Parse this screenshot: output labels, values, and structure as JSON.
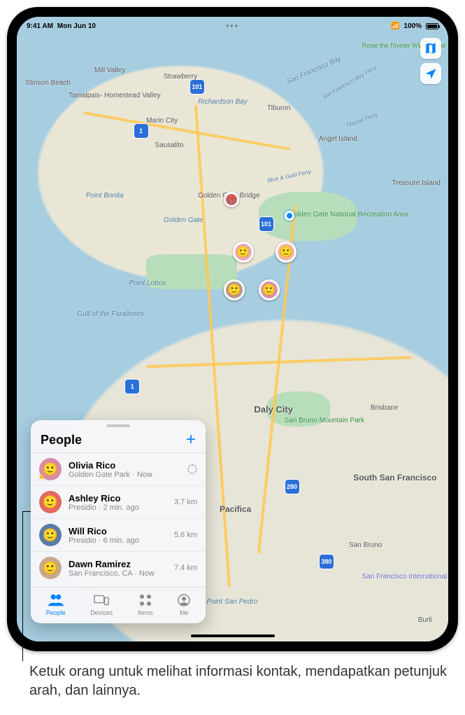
{
  "statusbar": {
    "time": "9:41 AM",
    "date": "Mon Jun 10",
    "battery": "100%"
  },
  "map_controls": {
    "maps_icon": "maps-icon",
    "locate_icon": "locate-icon"
  },
  "map_labels": {
    "mill_valley": "Mill Valley",
    "tamalpais": "Tamalpais-\nHomestead Valley",
    "strawberry": "Strawberry",
    "stinson": "Stinson Beach",
    "marin_city": "Marin City",
    "richardson_bay": "Richardson\nBay",
    "sausalito": "Sausalito",
    "tiburon": "Tiburon",
    "angel_island": "Angel\nIsland",
    "treasure_island": "Treasure\nIsland",
    "golden_gate_bridge": "Golden Gate\nBridge",
    "golden_gate": "Golden\nGate",
    "ggnra": "Golden Gate\nNational\nRecreation Area",
    "point_bonita": "Point Bonita",
    "point_lobos": "Point Lobos",
    "gulf": "Gulf\nof the\nFarallones",
    "daly_city": "Daly City",
    "brisbane": "Brisbane",
    "ssf": "South San\nFrancisco",
    "pacifica": "Pacifica",
    "san_bruno": "San Bruno",
    "burlingame": "Burli",
    "psp": "Point San Pedro",
    "san_bruno_park": "San Bruno\nMountain Park",
    "rosie": "Rosie the\nRiveter WWII\nHome Front\nNational\nHistorical Park",
    "sfo": "San Francisco\nInternational\nAirport",
    "sfbay": "San Francisco Bay",
    "bgferry": "Blue & Gold Ferry",
    "tibferry": "Tiburon Ferry",
    "sfbferry": "San Francisco Bay Ferry"
  },
  "shields": {
    "s1": "1",
    "s101": "101",
    "s280": "280",
    "s380": "380"
  },
  "panel": {
    "title": "People",
    "people": [
      {
        "name": "Olivia Rico",
        "sub": "Golden Gate Park · Now",
        "dist": "",
        "loading": true,
        "star": true,
        "av_bg": "#d88aa8"
      },
      {
        "name": "Ashley Rico",
        "sub": "Presidio · 2 min. ago",
        "dist": "3.7 km",
        "loading": false,
        "star": false,
        "av_bg": "#e06a60"
      },
      {
        "name": "Will Rico",
        "sub": "Presidio · 6 min. ago",
        "dist": "5.6 km",
        "loading": false,
        "star": false,
        "av_bg": "#5a7aa8"
      },
      {
        "name": "Dawn Ramirez",
        "sub": "San Francisco, CA · Now",
        "dist": "7.4 km",
        "loading": false,
        "star": false,
        "av_bg": "#c8a888"
      }
    ],
    "tabs": [
      {
        "id": "people",
        "label": "People",
        "active": true
      },
      {
        "id": "devices",
        "label": "Devices",
        "active": false
      },
      {
        "id": "items",
        "label": "Items",
        "active": false
      },
      {
        "id": "me",
        "label": "Me",
        "active": false
      }
    ]
  },
  "caption": "Ketuk orang untuk melihat informasi kontak, mendapatkan petunjuk arah, dan lainnya."
}
